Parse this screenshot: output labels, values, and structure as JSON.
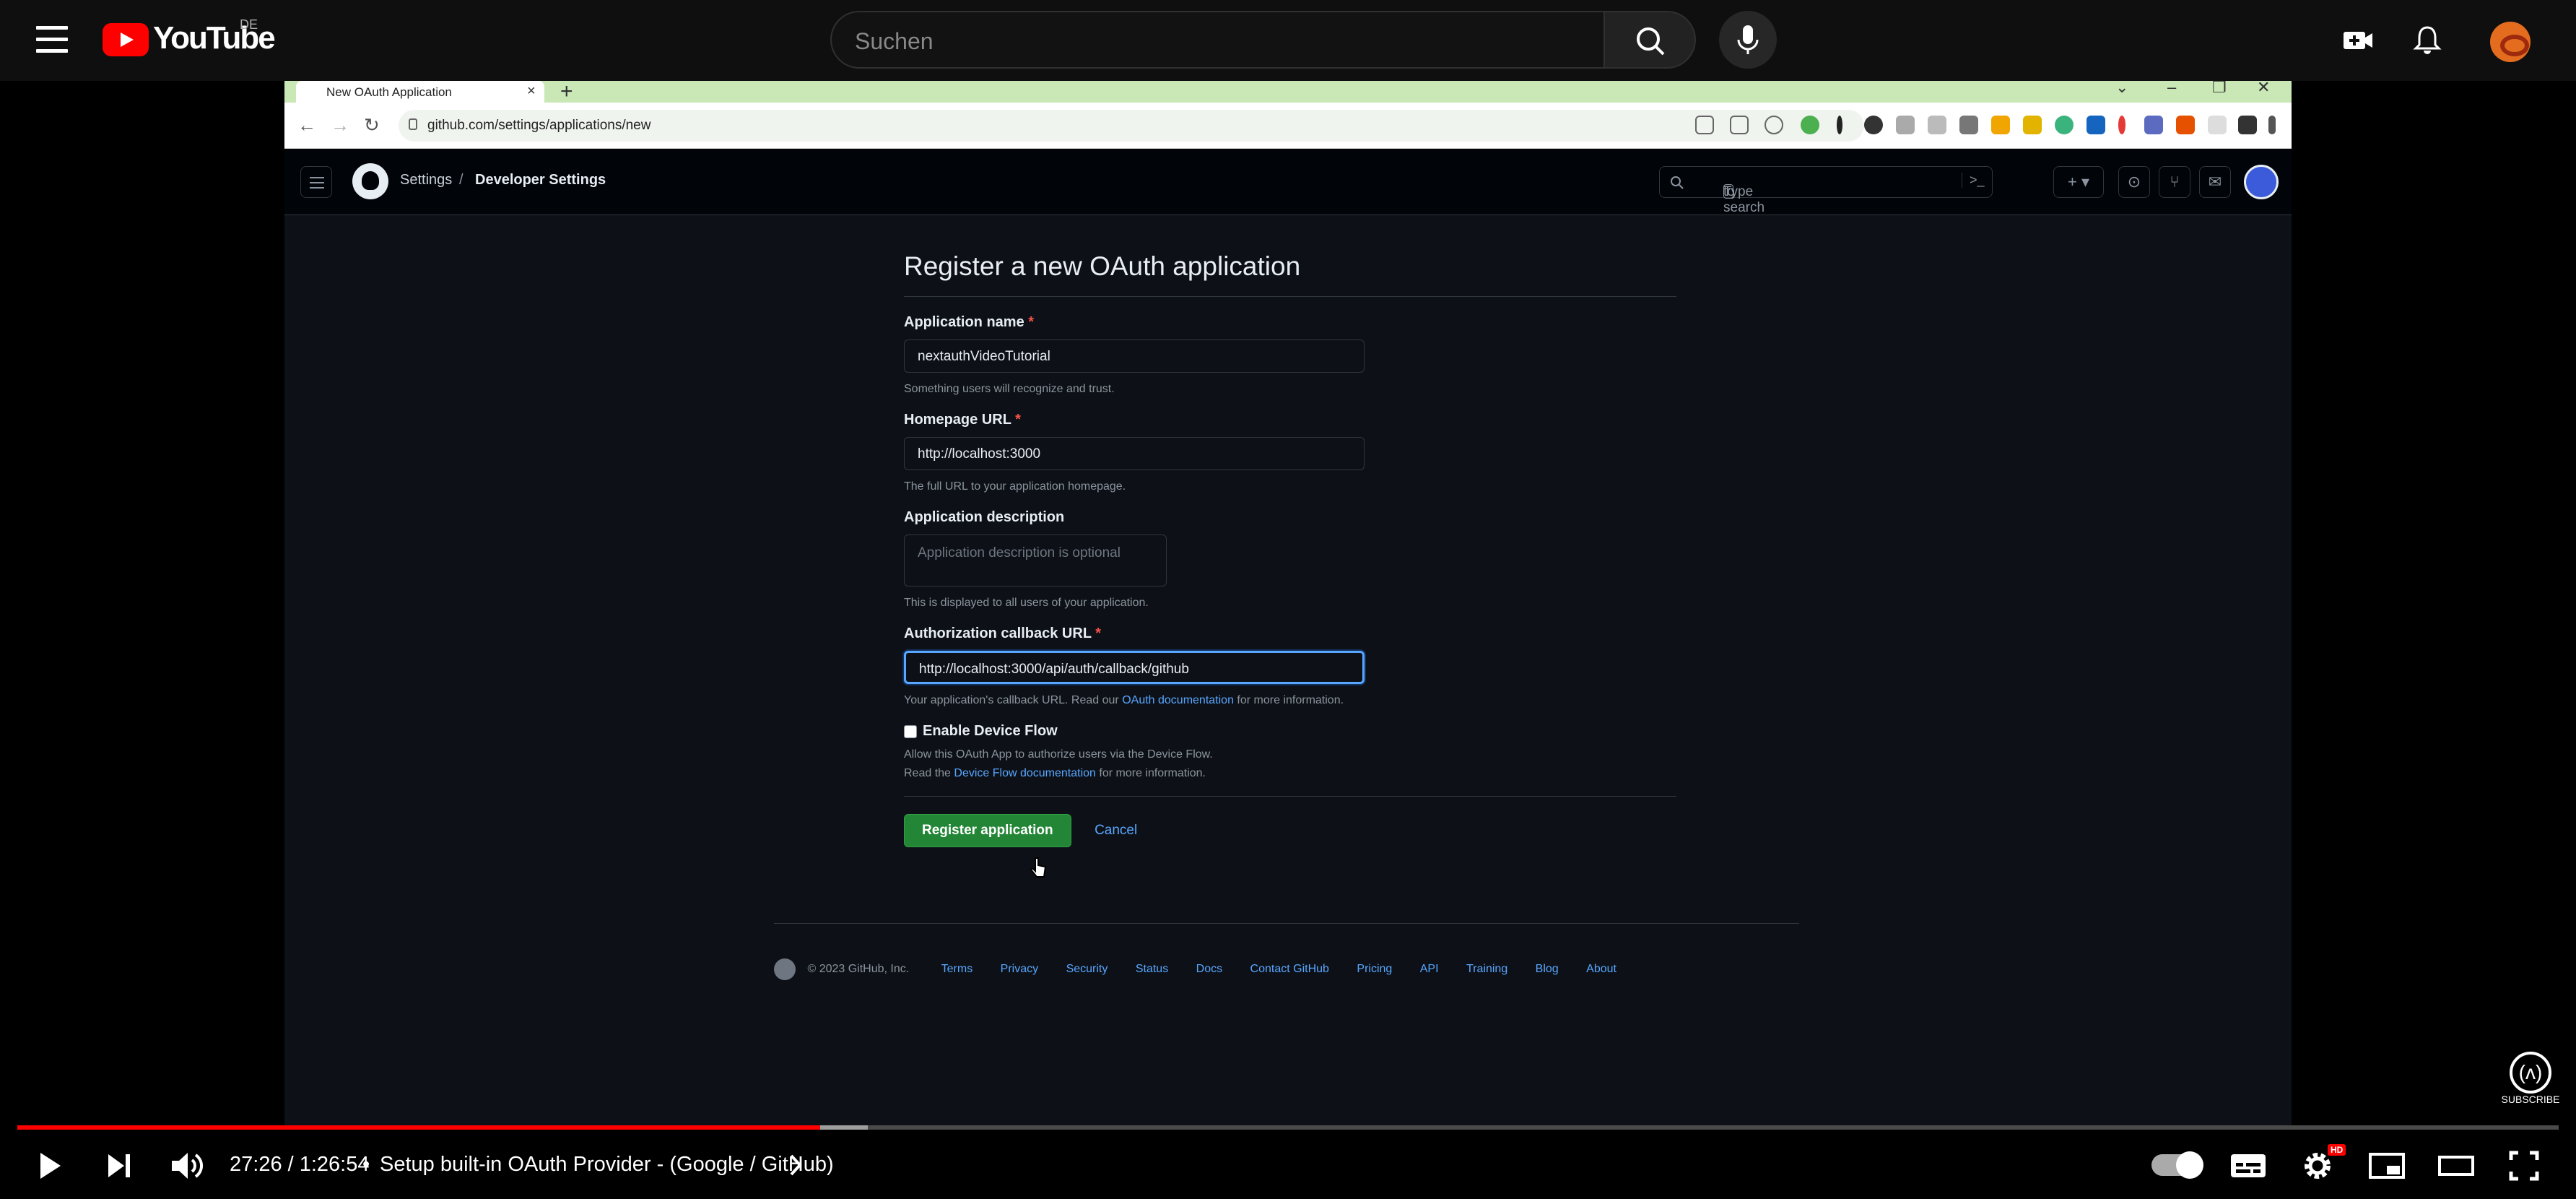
{
  "youtube": {
    "logo_text": "YouTube",
    "region": "DE",
    "search_placeholder": "Suchen"
  },
  "browser": {
    "tab_title": "New OAuth Application",
    "url": "github.com/settings/applications/new"
  },
  "github": {
    "breadcrumb": {
      "settings": "Settings",
      "separator": "/",
      "developer": "Developer Settings"
    },
    "search_placeholder_pre": "Type",
    "search_slash": "/",
    "search_placeholder_post": "to search",
    "form": {
      "title": "Register a new OAuth application",
      "required_mark": "*",
      "app_name_label": "Application name",
      "app_name_value": "nextauthVideoTutorial",
      "app_name_note": "Something users will recognize and trust.",
      "homepage_label": "Homepage URL",
      "homepage_value": "http://localhost:3000",
      "homepage_note": "The full URL to your application homepage.",
      "desc_label": "Application description",
      "desc_placeholder": "Application description is optional",
      "desc_note": "This is displayed to all users of your application.",
      "callback_label": "Authorization callback URL",
      "callback_value": "http://localhost:3000/api/auth/callback/github",
      "callback_note_pre": "Your application's callback URL. Read our",
      "callback_note_link": "OAuth documentation",
      "callback_note_post": "for more information.",
      "device_flow_label": "Enable Device Flow",
      "device_flow_note1": "Allow this OAuth App to authorize users via the Device Flow.",
      "device_flow_note2_pre": "Read the",
      "device_flow_note2_link": "Device Flow documentation",
      "device_flow_note2_post": "for more information.",
      "register_button": "Register application",
      "cancel_button": "Cancel"
    },
    "footer": {
      "copyright": "© 2023 GitHub, Inc.",
      "links": [
        "Terms",
        "Privacy",
        "Security",
        "Status",
        "Docs",
        "Contact GitHub",
        "Pricing",
        "API",
        "Training",
        "Blog",
        "About"
      ]
    }
  },
  "player": {
    "time": "27:26 / 1:26:54",
    "separator": "•",
    "chapter": "Setup built-in OAuth Provider - (Google / GitHub)",
    "subscribe_label": "SUBSCRIBE",
    "hd_badge": "HD",
    "progress_played_color": "#ff0000",
    "progress_buffered_color": "#9e9e9e",
    "progress_track_color": "#4a4a4a"
  },
  "colors": {
    "youtube_red": "#ff0000",
    "github_green": "#238636",
    "github_link": "#58a6ff",
    "github_bg": "#0d1117"
  }
}
